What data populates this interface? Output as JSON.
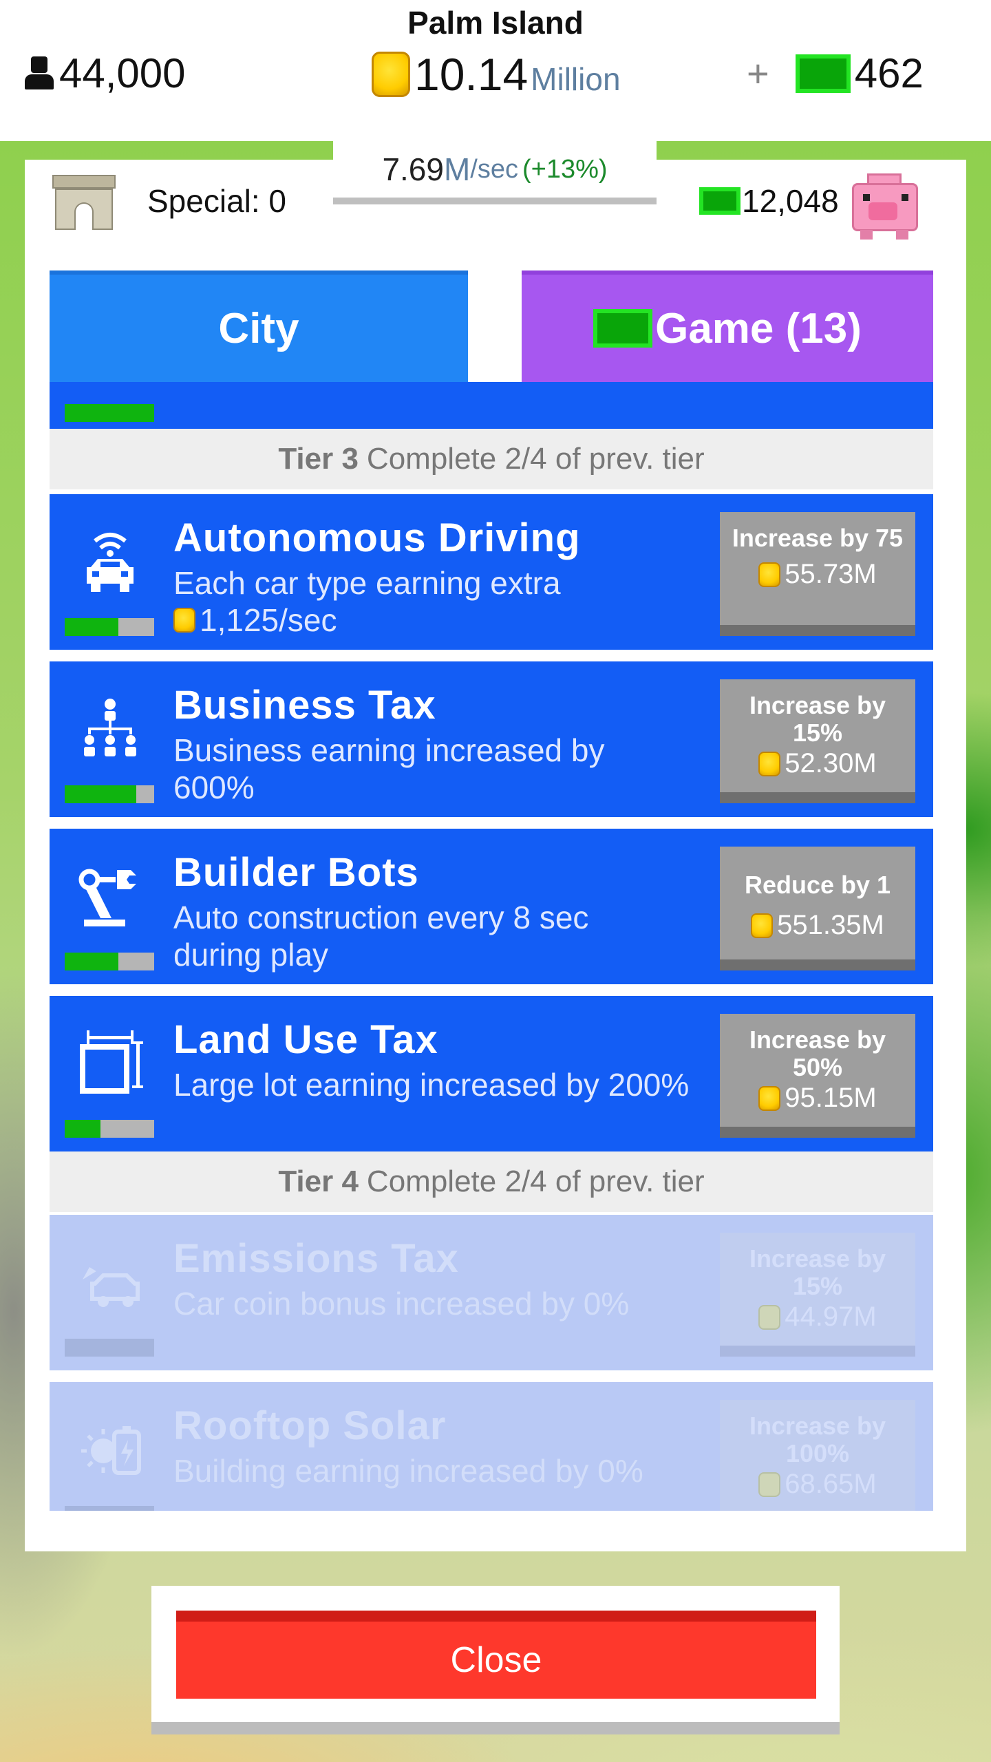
{
  "header": {
    "island_name": "Palm Island",
    "population": "44,000",
    "coins_value": "10.14",
    "coins_unit": "Million",
    "plus": "+",
    "cash": "462"
  },
  "rate": {
    "value": "7.69",
    "unit": "M",
    "per": "/sec",
    "bonus": "(+13%)"
  },
  "special": {
    "label": "Special: 0"
  },
  "bank": {
    "value": "12,048"
  },
  "tabs": [
    {
      "label": "City"
    },
    {
      "label": "Game (13)"
    }
  ],
  "tiers": [
    {
      "name": "Tier 3",
      "requirement": "Complete 2/4 of prev. tier"
    },
    {
      "name": "Tier 4",
      "requirement": "Complete 2/4 of prev. tier"
    }
  ],
  "upgrades": [
    {
      "title": "Autonomous Driving",
      "desc_line1": "Each car type earning extra",
      "desc_line2": "1,125/sec",
      "button_label": "Increase by 75",
      "cost": "55.73M",
      "progress": 0.6,
      "icon": "autonomous-car-icon",
      "locked": false
    },
    {
      "title": "Business Tax",
      "desc_line1": "Business earning increased by",
      "desc_line2": "600%",
      "button_label": "Increase by 15%",
      "cost": "52.30M",
      "progress": 0.8,
      "icon": "org-chart-icon",
      "locked": false
    },
    {
      "title": "Builder Bots",
      "desc_line1": "Auto construction every 8 sec",
      "desc_line2": "during play",
      "button_label": "Reduce by 1",
      "cost": "551.35M",
      "progress": 0.6,
      "icon": "robot-arm-icon",
      "locked": false
    },
    {
      "title": "Land Use Tax",
      "desc_line1": "Large lot earning increased by 200%",
      "desc_line2": "",
      "button_label": "Increase by 50%",
      "cost": "95.15M",
      "progress": 0.4,
      "icon": "land-plot-icon",
      "locked": false
    },
    {
      "title": "Emissions Tax",
      "desc_line1": "Car coin bonus increased by 0%",
      "desc_line2": "",
      "button_label": "Increase by 15%",
      "cost": "44.97M",
      "progress": 0,
      "icon": "exhaust-car-icon",
      "locked": true
    },
    {
      "title": "Rooftop Solar",
      "desc_line1": "Building earning increased by 0%",
      "desc_line2": "",
      "button_label": "Increase by 100%",
      "cost": "68.65M",
      "progress": 0,
      "icon": "solar-battery-icon",
      "locked": true
    }
  ],
  "close": {
    "label": "Close"
  },
  "colors": {
    "row_blue": "#135df5",
    "tab_city": "#2186f5",
    "tab_game": "#a757f0",
    "progress_green": "#0fb40f",
    "close_red": "#fe382c"
  }
}
